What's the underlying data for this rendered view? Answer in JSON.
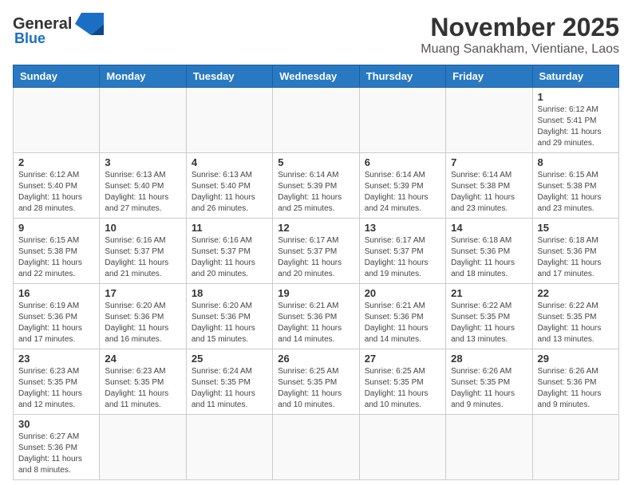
{
  "header": {
    "logo_line1": "General",
    "logo_line2": "Blue",
    "month_title": "November 2025",
    "subtitle": "Muang Sanakham, Vientiane, Laos"
  },
  "days_of_week": [
    "Sunday",
    "Monday",
    "Tuesday",
    "Wednesday",
    "Thursday",
    "Friday",
    "Saturday"
  ],
  "weeks": [
    [
      {
        "day": "",
        "info": ""
      },
      {
        "day": "",
        "info": ""
      },
      {
        "day": "",
        "info": ""
      },
      {
        "day": "",
        "info": ""
      },
      {
        "day": "",
        "info": ""
      },
      {
        "day": "",
        "info": ""
      },
      {
        "day": "1",
        "info": "Sunrise: 6:12 AM\nSunset: 5:41 PM\nDaylight: 11 hours\nand 29 minutes."
      }
    ],
    [
      {
        "day": "2",
        "info": "Sunrise: 6:12 AM\nSunset: 5:40 PM\nDaylight: 11 hours\nand 28 minutes."
      },
      {
        "day": "3",
        "info": "Sunrise: 6:13 AM\nSunset: 5:40 PM\nDaylight: 11 hours\nand 27 minutes."
      },
      {
        "day": "4",
        "info": "Sunrise: 6:13 AM\nSunset: 5:40 PM\nDaylight: 11 hours\nand 26 minutes."
      },
      {
        "day": "5",
        "info": "Sunrise: 6:14 AM\nSunset: 5:39 PM\nDaylight: 11 hours\nand 25 minutes."
      },
      {
        "day": "6",
        "info": "Sunrise: 6:14 AM\nSunset: 5:39 PM\nDaylight: 11 hours\nand 24 minutes."
      },
      {
        "day": "7",
        "info": "Sunrise: 6:14 AM\nSunset: 5:38 PM\nDaylight: 11 hours\nand 23 minutes."
      },
      {
        "day": "8",
        "info": "Sunrise: 6:15 AM\nSunset: 5:38 PM\nDaylight: 11 hours\nand 23 minutes."
      }
    ],
    [
      {
        "day": "9",
        "info": "Sunrise: 6:15 AM\nSunset: 5:38 PM\nDaylight: 11 hours\nand 22 minutes."
      },
      {
        "day": "10",
        "info": "Sunrise: 6:16 AM\nSunset: 5:37 PM\nDaylight: 11 hours\nand 21 minutes."
      },
      {
        "day": "11",
        "info": "Sunrise: 6:16 AM\nSunset: 5:37 PM\nDaylight: 11 hours\nand 20 minutes."
      },
      {
        "day": "12",
        "info": "Sunrise: 6:17 AM\nSunset: 5:37 PM\nDaylight: 11 hours\nand 20 minutes."
      },
      {
        "day": "13",
        "info": "Sunrise: 6:17 AM\nSunset: 5:37 PM\nDaylight: 11 hours\nand 19 minutes."
      },
      {
        "day": "14",
        "info": "Sunrise: 6:18 AM\nSunset: 5:36 PM\nDaylight: 11 hours\nand 18 minutes."
      },
      {
        "day": "15",
        "info": "Sunrise: 6:18 AM\nSunset: 5:36 PM\nDaylight: 11 hours\nand 17 minutes."
      }
    ],
    [
      {
        "day": "16",
        "info": "Sunrise: 6:19 AM\nSunset: 5:36 PM\nDaylight: 11 hours\nand 17 minutes."
      },
      {
        "day": "17",
        "info": "Sunrise: 6:20 AM\nSunset: 5:36 PM\nDaylight: 11 hours\nand 16 minutes."
      },
      {
        "day": "18",
        "info": "Sunrise: 6:20 AM\nSunset: 5:36 PM\nDaylight: 11 hours\nand 15 minutes."
      },
      {
        "day": "19",
        "info": "Sunrise: 6:21 AM\nSunset: 5:36 PM\nDaylight: 11 hours\nand 14 minutes."
      },
      {
        "day": "20",
        "info": "Sunrise: 6:21 AM\nSunset: 5:36 PM\nDaylight: 11 hours\nand 14 minutes."
      },
      {
        "day": "21",
        "info": "Sunrise: 6:22 AM\nSunset: 5:35 PM\nDaylight: 11 hours\nand 13 minutes."
      },
      {
        "day": "22",
        "info": "Sunrise: 6:22 AM\nSunset: 5:35 PM\nDaylight: 11 hours\nand 13 minutes."
      }
    ],
    [
      {
        "day": "23",
        "info": "Sunrise: 6:23 AM\nSunset: 5:35 PM\nDaylight: 11 hours\nand 12 minutes."
      },
      {
        "day": "24",
        "info": "Sunrise: 6:23 AM\nSunset: 5:35 PM\nDaylight: 11 hours\nand 11 minutes."
      },
      {
        "day": "25",
        "info": "Sunrise: 6:24 AM\nSunset: 5:35 PM\nDaylight: 11 hours\nand 11 minutes."
      },
      {
        "day": "26",
        "info": "Sunrise: 6:25 AM\nSunset: 5:35 PM\nDaylight: 11 hours\nand 10 minutes."
      },
      {
        "day": "27",
        "info": "Sunrise: 6:25 AM\nSunset: 5:35 PM\nDaylight: 11 hours\nand 10 minutes."
      },
      {
        "day": "28",
        "info": "Sunrise: 6:26 AM\nSunset: 5:35 PM\nDaylight: 11 hours\nand 9 minutes."
      },
      {
        "day": "29",
        "info": "Sunrise: 6:26 AM\nSunset: 5:36 PM\nDaylight: 11 hours\nand 9 minutes."
      }
    ],
    [
      {
        "day": "30",
        "info": "Sunrise: 6:27 AM\nSunset: 5:36 PM\nDaylight: 11 hours\nand 8 minutes."
      },
      {
        "day": "",
        "info": ""
      },
      {
        "day": "",
        "info": ""
      },
      {
        "day": "",
        "info": ""
      },
      {
        "day": "",
        "info": ""
      },
      {
        "day": "",
        "info": ""
      },
      {
        "day": "",
        "info": ""
      }
    ]
  ]
}
